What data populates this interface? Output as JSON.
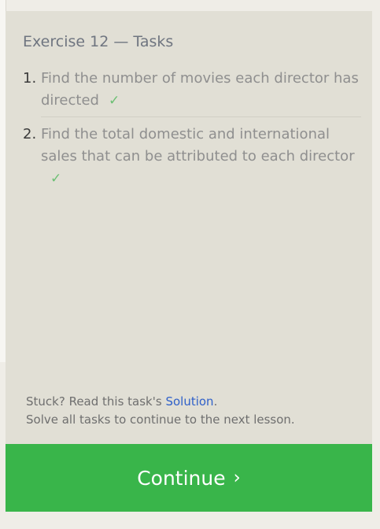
{
  "panel": {
    "title_prefix": "Exercise 12",
    "title_sep": "—",
    "title_suffix": "Tasks"
  },
  "tasks": [
    {
      "number": "1.",
      "text": "Find the number of movies each director has directed",
      "status": "✓"
    },
    {
      "number": "2.",
      "text": "Find the total domestic and international sales that can be attributed to each director",
      "status": "✓"
    }
  ],
  "footer": {
    "stuck_prefix": "Stuck? Read this task's ",
    "solution_link": "Solution",
    "stuck_suffix": ".",
    "hint": "Solve all tasks to continue to the next lesson."
  },
  "continue_button": {
    "label": "Continue",
    "chevron": "›"
  },
  "colors": {
    "panel_bg": "#e1dfd5",
    "button_bg": "#39b54a",
    "check": "#6cbf73",
    "link": "#2f60c9"
  }
}
